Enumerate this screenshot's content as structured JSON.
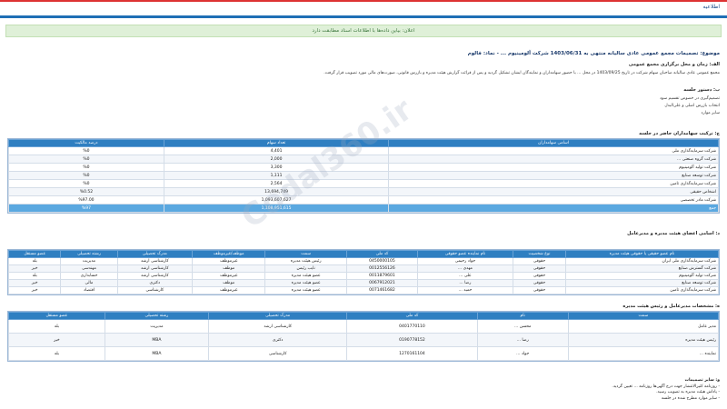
{
  "header": {
    "site_label": "اطلاعیه"
  },
  "alert": {
    "text": "اعلان: بیاین داده‌ها با اطلاعات اسناد مطابقت دارد"
  },
  "title": "موضوع: تصمیمات مجمع عمومی عادی سالیانه منتهی به 1403/06/31 شرکت آلومینیوم ... - نماد: فالوم",
  "subtitle": "الف: زمان و محل برگزاری مجمع عمومی",
  "para1": "مجمع عمومی عادی سالیانه صاحبان سهام شرکت در تاریخ 1403/09/25 در محل ... با حضور سهامداران و نمایندگان ایشان تشکیل گردید و پس از قرائت گزارش هیئت مدیره و بازرس قانونی، صورت‌های مالی مورد تصویب قرار گرفت.",
  "section_b": "ب: دستور جلسه",
  "agenda": [
    "تصمیم‌گیری در خصوص تقسیم سود",
    "انتخاب بازرس اصلی و علی‌البدل",
    "سایر موارد"
  ],
  "section_c": "ج: ترکیب سهامداران حاضر در جلسه",
  "shareholders": {
    "headers": [
      "اسامی سهامداران",
      "تعداد سهام",
      "درصد مالکیت"
    ],
    "rows": [
      [
        "شرکت سرمایه‌گذاری ملی",
        "4,401",
        "%0"
      ],
      [
        "شرکت گروه صنعتی ...",
        "2,000",
        "%0"
      ],
      [
        "شرکت تولید آلومینیوم",
        "3,300",
        "%0"
      ],
      [
        "شرکت توسعه صنایع",
        "1,111",
        "%0"
      ],
      [
        "شرکت سرمایه‌گذاری تامین",
        "2,564",
        "%0"
      ],
      [
        "اشخاص حقیقی",
        "13,694,749",
        "%0.52"
      ],
      [
        "شرکت مادر تخصصی",
        "1,093,607,627",
        "%97.00"
      ],
      [
        "جمع",
        "1,108,951,615",
        "%97"
      ]
    ]
  },
  "section_d": "د: اسامی اعضای هیئت مدیره و مدیرعامل",
  "board": {
    "headers": [
      "نام عضو حقیقی یا حقوقی هیئت مدیره",
      "نوع شخصیت",
      "نام نماینده عضو حقوقی",
      "کد ملی",
      "سمت",
      "موظف/غیرموظف",
      "مدرک تحصیلی",
      "رشته تحصیلی",
      "عضو مستقل"
    ],
    "rows": [
      [
        "شرکت سرمایه‌گذاری ملی ایران",
        "حقوقی",
        "جواد رحیمی",
        "0450000105",
        "رئیس هیئت مدیره",
        "غیرموظف",
        "کارشناسی ارشد",
        "مدیریت",
        "بله"
      ],
      [
        "شرکت گسترش صنایع",
        "حقوقی",
        "مهدی ...",
        "0012556126",
        "نایب رئیس",
        "موظف",
        "کارشناسی ارشد",
        "مهندسی",
        "خیر"
      ],
      [
        "شرکت تولید آلومینیوم",
        "حقوقی",
        "علی ...",
        "0011879601",
        "عضو هیئت مدیره",
        "غیرموظف",
        "کارشناسی ارشد",
        "حسابداری",
        "بله"
      ],
      [
        "شرکت توسعه صنایع",
        "حقوقی",
        "رضا ...",
        "0067912021",
        "عضو هیئت مدیره",
        "موظف",
        "دکتری",
        "مالی",
        "خیر"
      ],
      [
        "شرکت سرمایه‌گذاری تامین",
        "حقوقی",
        "حمید ...",
        "0071461682",
        "عضو هیئت مدیره",
        "غیرموظف",
        "کارشناسی",
        "اقتصاد",
        "خیر"
      ]
    ]
  },
  "section_e": "ه: مشخصات مدیرعامل و رئیس هیئت مدیره",
  "ceo": {
    "headers": [
      "سمت",
      "نام",
      "کد ملی",
      "مدرک تحصیلی",
      "رشته تحصیلی",
      "عضو مستقل"
    ],
    "rows": [
      [
        "مدیر عامل",
        "محسن ...",
        "0401770110",
        "کارشناسی ارشد",
        "مدیریت",
        "بله"
      ],
      [
        "رئیس هیئت مدیره",
        "رضا ...",
        "0190778152",
        "دکتری",
        "MBA",
        "خیر"
      ],
      [
        "نماینده ...",
        "جواد ...",
        "1270161104",
        "کارشناسی",
        "MBA",
        "بله"
      ]
    ]
  },
  "notes": {
    "title": "و: سایر تصمیمات",
    "lines": [
      "- روزنامه کثیرالانتشار جهت درج آگهی‌ها روزنامه ... تعیین گردید.",
      "- پاداش هیئت مدیره به تصویب رسید.",
      "- سایر موارد مطرح شده در جلسه"
    ]
  },
  "watermark": "Codal360.ir"
}
